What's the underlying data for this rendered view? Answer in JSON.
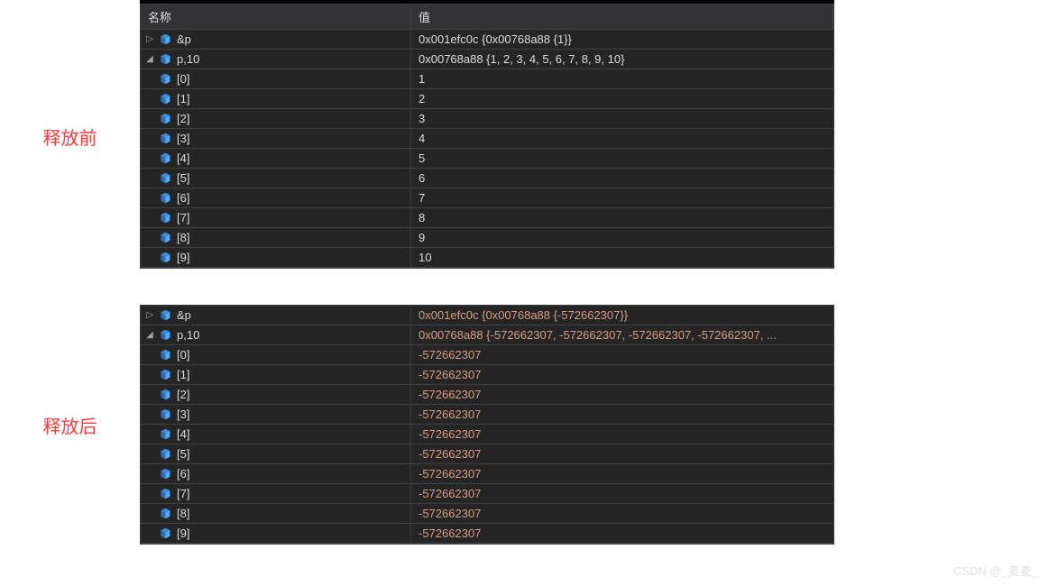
{
  "labels": {
    "before": "释放前",
    "after": "释放后"
  },
  "columns": {
    "name": "名称",
    "value": "值"
  },
  "before": {
    "showHeader": true,
    "rows": [
      {
        "depth": 0,
        "expander": "closed",
        "name": "&p",
        "value": "0x001efc0c {0x00768a88 {1}}",
        "stale": false
      },
      {
        "depth": 0,
        "expander": "open",
        "name": "p,10",
        "value": "0x00768a88 {1, 2, 3, 4, 5, 6, 7, 8, 9, 10}",
        "stale": false
      },
      {
        "depth": 2,
        "expander": "none",
        "name": "[0]",
        "value": "1",
        "stale": false
      },
      {
        "depth": 2,
        "expander": "none",
        "name": "[1]",
        "value": "2",
        "stale": false
      },
      {
        "depth": 2,
        "expander": "none",
        "name": "[2]",
        "value": "3",
        "stale": false
      },
      {
        "depth": 2,
        "expander": "none",
        "name": "[3]",
        "value": "4",
        "stale": false
      },
      {
        "depth": 2,
        "expander": "none",
        "name": "[4]",
        "value": "5",
        "stale": false
      },
      {
        "depth": 2,
        "expander": "none",
        "name": "[5]",
        "value": "6",
        "stale": false
      },
      {
        "depth": 2,
        "expander": "none",
        "name": "[6]",
        "value": "7",
        "stale": false
      },
      {
        "depth": 2,
        "expander": "none",
        "name": "[7]",
        "value": "8",
        "stale": false
      },
      {
        "depth": 2,
        "expander": "none",
        "name": "[8]",
        "value": "9",
        "stale": false
      },
      {
        "depth": 2,
        "expander": "none",
        "name": "[9]",
        "value": "10",
        "stale": false
      }
    ]
  },
  "after": {
    "showHeader": false,
    "rows": [
      {
        "depth": 0,
        "expander": "closed",
        "name": "&p",
        "value": "0x001efc0c {0x00768a88 {-572662307}}",
        "stale": true
      },
      {
        "depth": 0,
        "expander": "open",
        "name": "p,10",
        "value": "0x00768a88 {-572662307, -572662307, -572662307, -572662307, ...",
        "stale": true
      },
      {
        "depth": 2,
        "expander": "none",
        "name": "[0]",
        "value": "-572662307",
        "stale": true
      },
      {
        "depth": 2,
        "expander": "none",
        "name": "[1]",
        "value": "-572662307",
        "stale": true
      },
      {
        "depth": 2,
        "expander": "none",
        "name": "[2]",
        "value": "-572662307",
        "stale": true
      },
      {
        "depth": 2,
        "expander": "none",
        "name": "[3]",
        "value": "-572662307",
        "stale": true
      },
      {
        "depth": 2,
        "expander": "none",
        "name": "[4]",
        "value": "-572662307",
        "stale": true
      },
      {
        "depth": 2,
        "expander": "none",
        "name": "[5]",
        "value": "-572662307",
        "stale": true
      },
      {
        "depth": 2,
        "expander": "none",
        "name": "[6]",
        "value": "-572662307",
        "stale": true
      },
      {
        "depth": 2,
        "expander": "none",
        "name": "[7]",
        "value": "-572662307",
        "stale": true
      },
      {
        "depth": 2,
        "expander": "none",
        "name": "[8]",
        "value": "-572662307",
        "stale": true
      },
      {
        "depth": 2,
        "expander": "none",
        "name": "[9]",
        "value": "-572662307",
        "stale": true
      }
    ]
  },
  "watermark": "CSDN @_麦麦_"
}
